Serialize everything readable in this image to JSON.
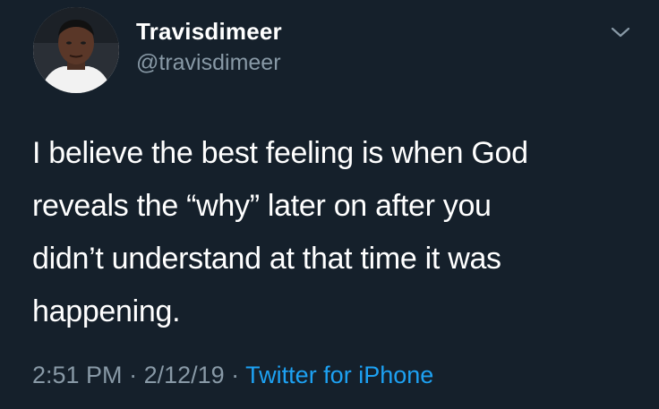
{
  "user": {
    "display_name": "Travisdimeer",
    "handle": "@travisdimeer",
    "avatar_icon": "profile-photo"
  },
  "tweet": {
    "lines": [
      "I believe the best feeling is when God",
      "reveals the “why” later on after you",
      "didn’t understand at that time it was",
      "happening."
    ]
  },
  "meta": {
    "time": "2:51 PM",
    "separator": " · ",
    "date": "2/12/19",
    "source": "Twitter for iPhone"
  },
  "icons": {
    "menu": "chevron-down-icon"
  },
  "colors": {
    "background": "#15202b",
    "text": "#ffffff",
    "secondary": "#8899a6",
    "link": "#1da1f2"
  }
}
